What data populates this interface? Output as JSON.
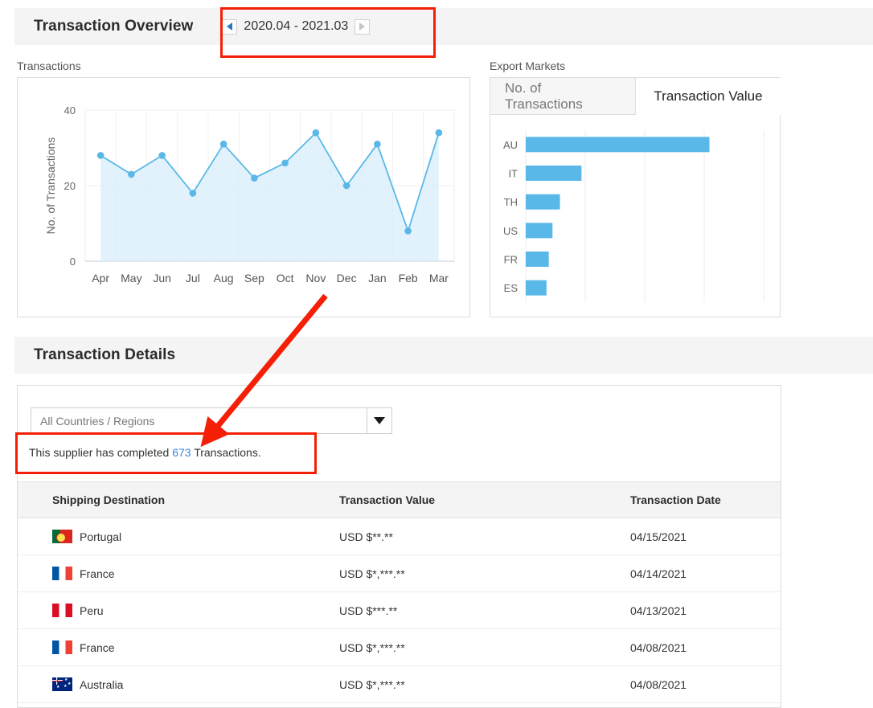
{
  "overview": {
    "title": "Transaction Overview",
    "date_range": {
      "label": "2020.04 - 2021.03",
      "prev_icon": "triangle-left-icon",
      "next_icon": "triangle-right-icon"
    },
    "transactions_label": "Transactions",
    "export_markets_label": "Export Markets",
    "tabs": [
      {
        "label": "No. of Transactions",
        "active": false
      },
      {
        "label": "Transaction Value",
        "active": true
      }
    ]
  },
  "details": {
    "title": "Transaction Details",
    "filter": {
      "value": "All Countries / Regions",
      "placeholder": "All Countries / Regions",
      "arrow_icon": "caret-down-icon"
    },
    "note": {
      "prefix": "This supplier has completed ",
      "count": "673",
      "suffix": " Transactions."
    },
    "table": {
      "columns": [
        "Shipping Destination",
        "Transaction Value",
        "Transaction Date"
      ],
      "rows": [
        {
          "flag": "flag-pt",
          "destination": "Portugal",
          "value": "USD $**.**",
          "date": "04/15/2021"
        },
        {
          "flag": "flag-fr",
          "destination": "France",
          "value": "USD $*,***.**",
          "date": "04/14/2021"
        },
        {
          "flag": "flag-pe",
          "destination": "Peru",
          "value": "USD $***.**",
          "date": "04/13/2021"
        },
        {
          "flag": "flag-fr",
          "destination": "France",
          "value": "USD $*,***.**",
          "date": "04/08/2021"
        },
        {
          "flag": "flag-au",
          "destination": "Australia",
          "value": "USD $*,***.**",
          "date": "04/08/2021"
        }
      ]
    }
  },
  "colors": {
    "accent_blue": "#5ab8e8",
    "area_fill": "#d8eefb",
    "link_blue": "#3a87d8",
    "annotation_red": "#f41f06",
    "header_gray": "#f4f4f4"
  },
  "chart_data": [
    {
      "type": "line",
      "title": "Transactions",
      "xlabel": "",
      "ylabel": "No. of Transactions",
      "categories": [
        "Apr",
        "May",
        "Jun",
        "Jul",
        "Aug",
        "Sep",
        "Oct",
        "Nov",
        "Dec",
        "Jan",
        "Feb",
        "Mar"
      ],
      "values": [
        28,
        23,
        28,
        18,
        31,
        22,
        26,
        34,
        20,
        31,
        8,
        34
      ],
      "ylim": [
        0,
        40
      ],
      "yticks": [
        0,
        20,
        40
      ],
      "grid": true,
      "area": true,
      "legend": "none"
    },
    {
      "type": "bar",
      "orientation": "horizontal",
      "title": "Export Markets",
      "subtitle": "Transaction Value",
      "categories": [
        "AU",
        "IT",
        "TH",
        "US",
        "FR",
        "ES"
      ],
      "values": [
        247,
        75,
        46,
        36,
        31,
        28
      ],
      "xlabel": "",
      "ylabel": "",
      "xlim": [
        0,
        320
      ],
      "grid": true,
      "legend": "none"
    }
  ]
}
